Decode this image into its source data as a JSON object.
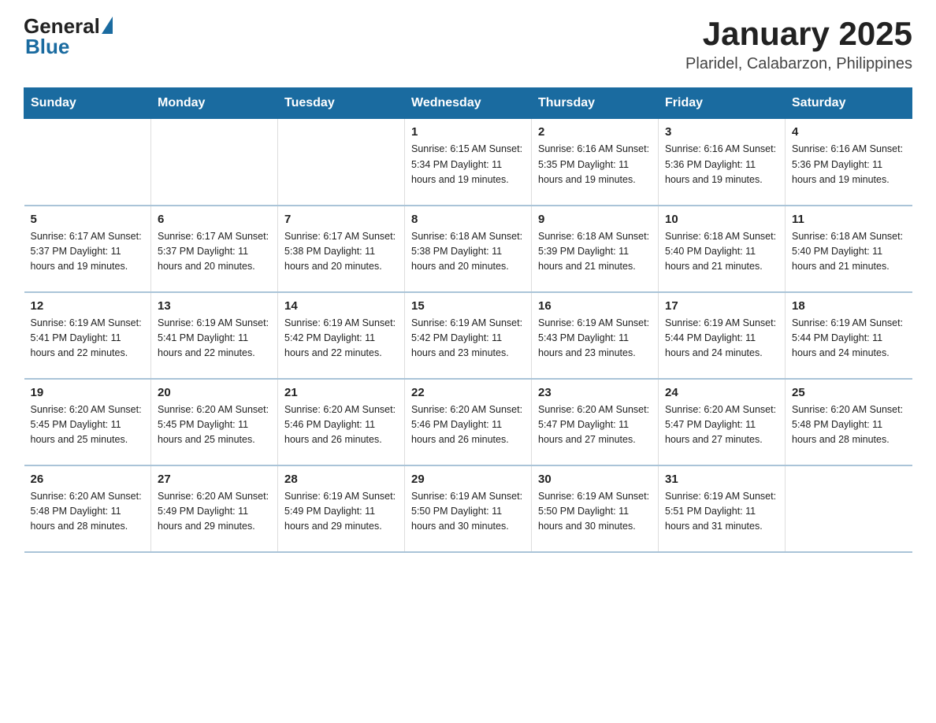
{
  "header": {
    "logo": {
      "general_text": "General",
      "blue_text": "Blue"
    },
    "title": "January 2025",
    "location": "Plaridel, Calabarzon, Philippines"
  },
  "weekdays": [
    "Sunday",
    "Monday",
    "Tuesday",
    "Wednesday",
    "Thursday",
    "Friday",
    "Saturday"
  ],
  "weeks": [
    [
      {
        "day": "",
        "info": ""
      },
      {
        "day": "",
        "info": ""
      },
      {
        "day": "",
        "info": ""
      },
      {
        "day": "1",
        "info": "Sunrise: 6:15 AM\nSunset: 5:34 PM\nDaylight: 11 hours\nand 19 minutes."
      },
      {
        "day": "2",
        "info": "Sunrise: 6:16 AM\nSunset: 5:35 PM\nDaylight: 11 hours\nand 19 minutes."
      },
      {
        "day": "3",
        "info": "Sunrise: 6:16 AM\nSunset: 5:36 PM\nDaylight: 11 hours\nand 19 minutes."
      },
      {
        "day": "4",
        "info": "Sunrise: 6:16 AM\nSunset: 5:36 PM\nDaylight: 11 hours\nand 19 minutes."
      }
    ],
    [
      {
        "day": "5",
        "info": "Sunrise: 6:17 AM\nSunset: 5:37 PM\nDaylight: 11 hours\nand 19 minutes."
      },
      {
        "day": "6",
        "info": "Sunrise: 6:17 AM\nSunset: 5:37 PM\nDaylight: 11 hours\nand 20 minutes."
      },
      {
        "day": "7",
        "info": "Sunrise: 6:17 AM\nSunset: 5:38 PM\nDaylight: 11 hours\nand 20 minutes."
      },
      {
        "day": "8",
        "info": "Sunrise: 6:18 AM\nSunset: 5:38 PM\nDaylight: 11 hours\nand 20 minutes."
      },
      {
        "day": "9",
        "info": "Sunrise: 6:18 AM\nSunset: 5:39 PM\nDaylight: 11 hours\nand 21 minutes."
      },
      {
        "day": "10",
        "info": "Sunrise: 6:18 AM\nSunset: 5:40 PM\nDaylight: 11 hours\nand 21 minutes."
      },
      {
        "day": "11",
        "info": "Sunrise: 6:18 AM\nSunset: 5:40 PM\nDaylight: 11 hours\nand 21 minutes."
      }
    ],
    [
      {
        "day": "12",
        "info": "Sunrise: 6:19 AM\nSunset: 5:41 PM\nDaylight: 11 hours\nand 22 minutes."
      },
      {
        "day": "13",
        "info": "Sunrise: 6:19 AM\nSunset: 5:41 PM\nDaylight: 11 hours\nand 22 minutes."
      },
      {
        "day": "14",
        "info": "Sunrise: 6:19 AM\nSunset: 5:42 PM\nDaylight: 11 hours\nand 22 minutes."
      },
      {
        "day": "15",
        "info": "Sunrise: 6:19 AM\nSunset: 5:42 PM\nDaylight: 11 hours\nand 23 minutes."
      },
      {
        "day": "16",
        "info": "Sunrise: 6:19 AM\nSunset: 5:43 PM\nDaylight: 11 hours\nand 23 minutes."
      },
      {
        "day": "17",
        "info": "Sunrise: 6:19 AM\nSunset: 5:44 PM\nDaylight: 11 hours\nand 24 minutes."
      },
      {
        "day": "18",
        "info": "Sunrise: 6:19 AM\nSunset: 5:44 PM\nDaylight: 11 hours\nand 24 minutes."
      }
    ],
    [
      {
        "day": "19",
        "info": "Sunrise: 6:20 AM\nSunset: 5:45 PM\nDaylight: 11 hours\nand 25 minutes."
      },
      {
        "day": "20",
        "info": "Sunrise: 6:20 AM\nSunset: 5:45 PM\nDaylight: 11 hours\nand 25 minutes."
      },
      {
        "day": "21",
        "info": "Sunrise: 6:20 AM\nSunset: 5:46 PM\nDaylight: 11 hours\nand 26 minutes."
      },
      {
        "day": "22",
        "info": "Sunrise: 6:20 AM\nSunset: 5:46 PM\nDaylight: 11 hours\nand 26 minutes."
      },
      {
        "day": "23",
        "info": "Sunrise: 6:20 AM\nSunset: 5:47 PM\nDaylight: 11 hours\nand 27 minutes."
      },
      {
        "day": "24",
        "info": "Sunrise: 6:20 AM\nSunset: 5:47 PM\nDaylight: 11 hours\nand 27 minutes."
      },
      {
        "day": "25",
        "info": "Sunrise: 6:20 AM\nSunset: 5:48 PM\nDaylight: 11 hours\nand 28 minutes."
      }
    ],
    [
      {
        "day": "26",
        "info": "Sunrise: 6:20 AM\nSunset: 5:48 PM\nDaylight: 11 hours\nand 28 minutes."
      },
      {
        "day": "27",
        "info": "Sunrise: 6:20 AM\nSunset: 5:49 PM\nDaylight: 11 hours\nand 29 minutes."
      },
      {
        "day": "28",
        "info": "Sunrise: 6:19 AM\nSunset: 5:49 PM\nDaylight: 11 hours\nand 29 minutes."
      },
      {
        "day": "29",
        "info": "Sunrise: 6:19 AM\nSunset: 5:50 PM\nDaylight: 11 hours\nand 30 minutes."
      },
      {
        "day": "30",
        "info": "Sunrise: 6:19 AM\nSunset: 5:50 PM\nDaylight: 11 hours\nand 30 minutes."
      },
      {
        "day": "31",
        "info": "Sunrise: 6:19 AM\nSunset: 5:51 PM\nDaylight: 11 hours\nand 31 minutes."
      },
      {
        "day": "",
        "info": ""
      }
    ]
  ]
}
